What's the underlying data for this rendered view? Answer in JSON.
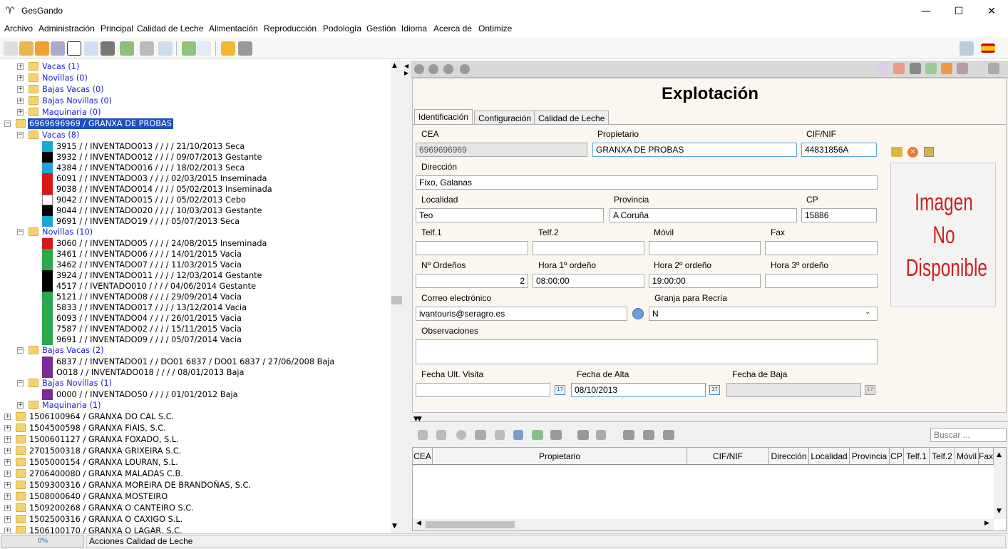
{
  "window": {
    "title": "GesGando",
    "minimize": "—",
    "maximize": "☐",
    "close": "✕"
  },
  "menu": [
    "Archivo",
    "Administración",
    "Principal",
    "Calidad de Leche",
    "Alimentación",
    "Reproducción",
    "Podología",
    "Gestión",
    "Idioma",
    "Acerca de",
    "Ontimize"
  ],
  "tree": {
    "top": [
      {
        "label": "Vacas (1)"
      },
      {
        "label": "Novillas (0)"
      },
      {
        "label": "Bajas Vacas (0)"
      },
      {
        "label": "Bajas Novillas (0)"
      },
      {
        "label": "Maquinaria (0)"
      }
    ],
    "selected": "6969696969 / GRANXA DE PROBAS",
    "vacas_label": "Vacas (8)",
    "vacas": [
      {
        "text": "3915 /  / INVENTADO013 /  /  /  / 21/10/2013 Seca",
        "icon": "seca"
      },
      {
        "text": "3932 /  / INVENTADO012 /  /  /  / 09/07/2013 Gestante",
        "icon": "gestante"
      },
      {
        "text": "4384 /  / INVENTADO016 /  /  /  / 18/02/2013 Seca",
        "icon": "seca"
      },
      {
        "text": "6091 /  / INVENTADO03 /  /  /  / 02/03/2015 Inseminada",
        "icon": "inseminada"
      },
      {
        "text": "9038 /  / INVENTADO014 /  /  /  / 05/02/2013 Inseminada",
        "icon": "inseminada"
      },
      {
        "text": "9042 /  / INVENTADO015 /  /  /  / 05/02/2013 Cebo",
        "icon": "cebo"
      },
      {
        "text": "9044 /  / INVENTADO020 /  /  /  / 10/03/2013 Gestante",
        "icon": "gestante"
      },
      {
        "text": "9691 /  / INVENTADO19 /  /  /  / 05/07/2013 Seca",
        "icon": "seca"
      }
    ],
    "novillas_label": "Novillas (10)",
    "novillas": [
      {
        "text": "3060 /  / INVENTADO05 /  /  /  / 24/08/2015 Inseminada",
        "icon": "inseminada"
      },
      {
        "text": "3461 /  / INVENTADO06 /  /  /  / 14/01/2015 Vacia",
        "icon": "vacia"
      },
      {
        "text": "3462 /  / INVENTADO07 /  /  /  / 11/03/2015 Vacia",
        "icon": "vacia"
      },
      {
        "text": "3924 /  / INVENTADO011 /  /  /  / 12/03/2014 Gestante",
        "icon": "gestante"
      },
      {
        "text": "4517 /  / IVENTADO010 /  /  /  / 04/06/2014 Gestante",
        "icon": "gestante"
      },
      {
        "text": "5121 /  / INVENTADO08 /  /  /  / 29/09/2014 Vacia",
        "icon": "vacia"
      },
      {
        "text": "5833 /  / INVENTADO017 /  /  /  / 13/12/2014 Vacia",
        "icon": "vacia"
      },
      {
        "text": "6093 /  / INVENTADO04 /  /  /  / 26/01/2015 Vacia",
        "icon": "vacia"
      },
      {
        "text": "7587 /  / INVENTADO02 /  /  /  / 15/11/2015 Vacia",
        "icon": "vacia"
      },
      {
        "text": "9691 /  / INVENTADO09 /  /  /  / 05/07/2014 Vacia",
        "icon": "vacia"
      }
    ],
    "bajas_vacas_label": "Bajas Vacas (2)",
    "bajas_vacas": [
      {
        "text": "6837 /  / INVENTADO01 /  / DO01 6837 / DO01 6837 / 27/06/2008 Baja",
        "icon": "baja"
      },
      {
        "text": "O018 /  / INVENTADO018 /  /  /  / 08/01/2013 Baja",
        "icon": "baja"
      }
    ],
    "bajas_novillas_label": "Bajas Novillas (1)",
    "bajas_novillas": [
      {
        "text": "0000 /  / INVENTADO50 /  /  /  / 01/01/2012 Baja",
        "icon": "baja"
      }
    ],
    "maquinaria_label": "Maquinaria (1)",
    "farms": [
      "1506100964 / GRANXA DO CAL S.C.",
      "1504500598 / GRANXA FIAIS, S.C.",
      "1500601127 / GRANXA FOXADO, S.L.",
      "2701500318 / GRANXA GRIXEIRA S.C.",
      "1505000154 / GRANXA LOURAN, S.L.",
      "2706400080 / GRANXA MALADAS C.B.",
      "1509300316 / GRANXA MOREIRA DE BRANDOÑAS, S.C.",
      "1508000640 / GRANXA MOSTEIRO",
      "1509200268 / GRANXA O CANTEIRO S.C.",
      "1502500316 / GRANXA O CAXIGO S.L.",
      "1506100170 / GRANXA O LAGAR, S.C."
    ]
  },
  "form": {
    "title": "Explotación",
    "tabs": [
      "Identificación",
      "Configuración",
      "Calidad de Leche"
    ],
    "labels": {
      "cea": "CEA",
      "propietario": "Propietario",
      "cif": "CIF/NIF",
      "direccion": "Dirección",
      "localidad": "Localidad",
      "provincia": "Provincia",
      "cp": "CP",
      "telf1": "Telf.1",
      "telf2": "Telf.2",
      "movil": "Móvil",
      "fax": "Fax",
      "ordenos": "Nº Ordeños",
      "hora1": "Hora 1º ordeño",
      "hora2": "Hora 2º ordeño",
      "hora3": "Hora 3º ordeño",
      "correo": "Correo electrónico",
      "granja": "Granja para Recría",
      "observaciones": "Observaciones",
      "fecha_visita": "Fecha Ult. Visita",
      "fecha_alta": "Fecha de Alta",
      "fecha_baja": "Fecha de Baja"
    },
    "values": {
      "cea": "6969696969",
      "propietario": "GRANXA DE PROBAS",
      "cif": "44831856A",
      "direccion": "Fixo, Galanas",
      "localidad": "Teo",
      "provincia": "A Coruña",
      "cp": "15886",
      "telf1": "",
      "telf2": "",
      "movil": "",
      "fax": "",
      "ordenos": "2",
      "hora1": "08:00:00",
      "hora2": "19:00:00",
      "hora3": "",
      "correo": "ivantouris@seragro.es",
      "granja": "N",
      "observaciones": "",
      "fecha_visita": "",
      "fecha_alta": "08/10/2013",
      "fecha_baja": ""
    },
    "image_text": [
      "Imagen",
      "No",
      "Disponible"
    ],
    "calendar_glyph": "17"
  },
  "grid": {
    "search_placeholder": "Buscar ...",
    "columns": [
      "CEA",
      "Propietario",
      "CIF/NIF",
      "Dirección",
      "Localidad",
      "Provincia",
      "CP",
      "Telf.1",
      "Telf.2",
      "Móvil",
      "Fax"
    ]
  },
  "status": {
    "progress": "0%",
    "progress_value": 0,
    "message": "Acciones Calidad de Leche"
  },
  "colors": {
    "seca": "#1fa3d8",
    "gestante": "#000000",
    "inseminada": "#d81818",
    "cebo": "#ffffff",
    "vacia": "#2aa84a",
    "baja": "#7a2b96",
    "link_blue": "#1b1bd6",
    "selection": "#1f4fbf"
  }
}
